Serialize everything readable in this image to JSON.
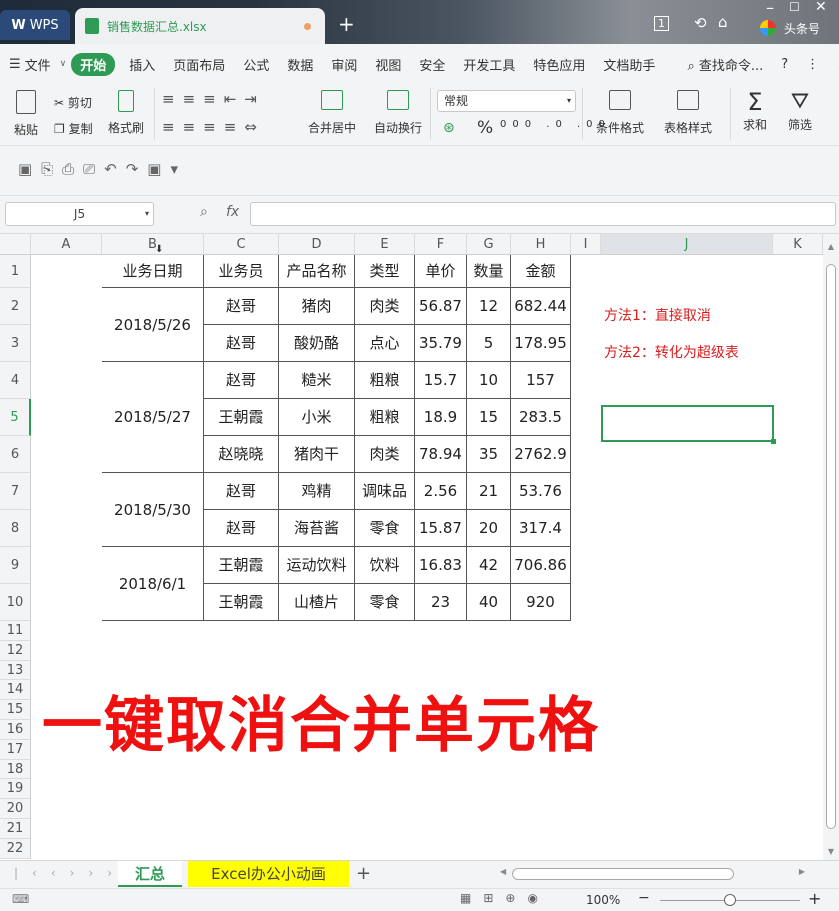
{
  "titlebar": {
    "app": "WPS",
    "file_tab": "销售数据汇总.xlsx",
    "badge": "1",
    "brand": "头条号"
  },
  "menu": [
    "文件",
    "开始",
    "插入",
    "页面布局",
    "公式",
    "数据",
    "审阅",
    "视图",
    "安全",
    "开发工具",
    "特色应用",
    "文档助手"
  ],
  "menu_search": "查找命令...",
  "ribbon": {
    "paste": "粘贴",
    "cut": "剪切",
    "copy": "复制",
    "format_painter": "格式刷",
    "merge_center": "合并居中",
    "wrap": "自动换行",
    "number_format": "常规",
    "percent": "%",
    "cond_format": "条件格式",
    "table_style": "表格样式",
    "sum": "求和",
    "filter": "筛选"
  },
  "formula": {
    "namebox": "J5",
    "fx": "fx",
    "value": ""
  },
  "columns": [
    "A",
    "B",
    "C",
    "D",
    "E",
    "F",
    "G",
    "H",
    "I",
    "J",
    "K"
  ],
  "rows": [
    "1",
    "2",
    "3",
    "4",
    "5",
    "6",
    "7",
    "8",
    "9",
    "10",
    "11",
    "12",
    "13",
    "14",
    "15",
    "16",
    "17",
    "18",
    "19",
    "20",
    "21",
    "22"
  ],
  "table": {
    "headers": [
      "业务日期",
      "业务员",
      "产品名称",
      "类型",
      "单价",
      "数量",
      "金额"
    ],
    "dates": [
      "2018/5/26",
      "2018/5/27",
      "2018/5/30",
      "2018/6/1"
    ],
    "rows": [
      [
        "赵哥",
        "猪肉",
        "肉类",
        "56.87",
        "12",
        "682.44"
      ],
      [
        "赵哥",
        "酸奶酪",
        "点心",
        "35.79",
        "5",
        "178.95"
      ],
      [
        "赵哥",
        "糙米",
        "粗粮",
        "15.7",
        "10",
        "157"
      ],
      [
        "王朝霞",
        "小米",
        "粗粮",
        "18.9",
        "15",
        "283.5"
      ],
      [
        "赵晓晓",
        "猪肉干",
        "肉类",
        "78.94",
        "35",
        "2762.9"
      ],
      [
        "赵哥",
        "鸡精",
        "调味品",
        "2.56",
        "21",
        "53.76"
      ],
      [
        "赵哥",
        "海苔酱",
        "零食",
        "15.87",
        "20",
        "317.4"
      ],
      [
        "王朝霞",
        "运动饮料",
        "饮料",
        "16.83",
        "42",
        "706.86"
      ],
      [
        "王朝霞",
        "山楂片",
        "零食",
        "23",
        "40",
        "920"
      ]
    ]
  },
  "notes": [
    "方法1：直接取消",
    "方法2：转化为超级表"
  ],
  "overlay_title": "一键取消合并单元格",
  "sheets": [
    "汇总",
    "Excel办公小动画"
  ],
  "status": {
    "zoom": "100%"
  },
  "colors": {
    "accent": "#2e9a55",
    "red_text": "#d81e1e",
    "sheet2_bg": "#ffff00"
  }
}
